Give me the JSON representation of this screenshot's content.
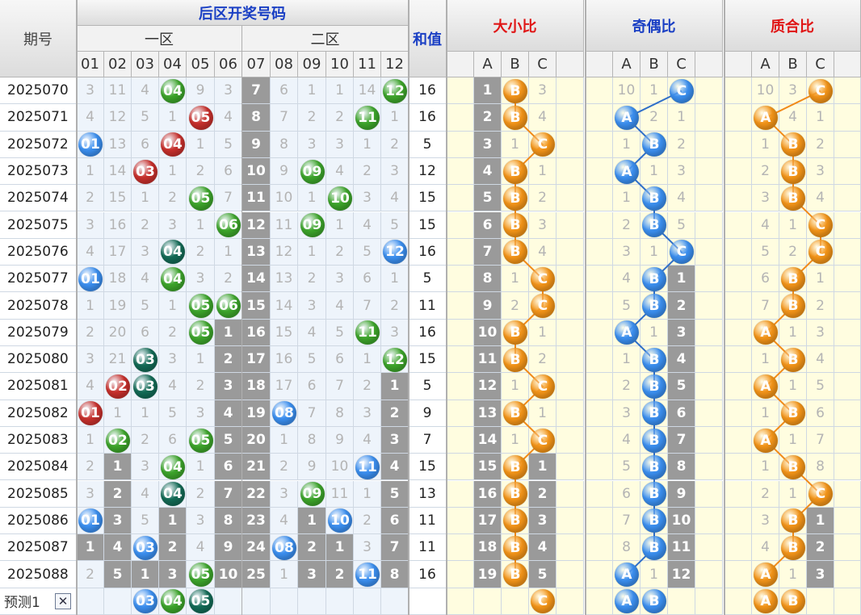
{
  "header": {
    "period": "期号",
    "back_zone": "后区开奖号码",
    "zone1": "一区",
    "zone2": "二区",
    "sum": "和值",
    "bigsmall": "大小比",
    "oddeven": "奇偶比",
    "primecomp": "质合比"
  },
  "numbers": [
    "01",
    "02",
    "03",
    "04",
    "05",
    "06",
    "07",
    "08",
    "09",
    "10",
    "11",
    "12"
  ],
  "abc": [
    "A",
    "B",
    "C"
  ],
  "colors": {
    "blue": "#3b8ff0",
    "red": "#c8302c",
    "green": "#3da52b",
    "teal": "#136b56",
    "orange": "#f39418"
  },
  "rows": [
    {
      "period": "2025070",
      "cells": [
        "3",
        "11",
        "4",
        "04",
        "9",
        "3",
        "7",
        "6",
        "1",
        "1",
        "14",
        "12"
      ],
      "balls": [
        {
          "col": 3,
          "color": "green"
        },
        {
          "col": 11,
          "color": "green"
        }
      ],
      "sum": "16",
      "bs": [
        "1",
        "B",
        "3"
      ],
      "oe": [
        "10",
        "1",
        "C"
      ],
      "pc": [
        "10",
        "3",
        "C"
      ]
    },
    {
      "period": "2025071",
      "cells": [
        "4",
        "12",
        "5",
        "1",
        "05",
        "4",
        "8",
        "7",
        "2",
        "2",
        "11",
        "1"
      ],
      "balls": [
        {
          "col": 4,
          "color": "red"
        },
        {
          "col": 10,
          "color": "green"
        }
      ],
      "sum": "16",
      "bs": [
        "2",
        "B",
        "4"
      ],
      "oe": [
        "A",
        "2",
        "1"
      ],
      "pc": [
        "A",
        "4",
        "1"
      ]
    },
    {
      "period": "2025072",
      "cells": [
        "01",
        "13",
        "6",
        "04",
        "1",
        "5",
        "9",
        "8",
        "3",
        "3",
        "1",
        "2"
      ],
      "balls": [
        {
          "col": 0,
          "color": "blue"
        },
        {
          "col": 3,
          "color": "red"
        }
      ],
      "sum": "5",
      "bs": [
        "3",
        "1",
        "C"
      ],
      "oe": [
        "1",
        "B",
        "2"
      ],
      "pc": [
        "1",
        "B",
        "2"
      ]
    },
    {
      "period": "2025073",
      "cells": [
        "1",
        "14",
        "03",
        "1",
        "2",
        "6",
        "10",
        "9",
        "09",
        "4",
        "2",
        "3"
      ],
      "balls": [
        {
          "col": 2,
          "color": "red"
        },
        {
          "col": 8,
          "color": "green"
        }
      ],
      "sum": "12",
      "bs": [
        "4",
        "B",
        "1"
      ],
      "oe": [
        "A",
        "1",
        "3"
      ],
      "pc": [
        "2",
        "B",
        "3"
      ]
    },
    {
      "period": "2025074",
      "cells": [
        "2",
        "15",
        "1",
        "2",
        "05",
        "7",
        "11",
        "10",
        "1",
        "10",
        "3",
        "4"
      ],
      "balls": [
        {
          "col": 4,
          "color": "green"
        },
        {
          "col": 9,
          "color": "green"
        }
      ],
      "sum": "15",
      "bs": [
        "5",
        "B",
        "2"
      ],
      "oe": [
        "1",
        "B",
        "4"
      ],
      "pc": [
        "3",
        "B",
        "4"
      ]
    },
    {
      "period": "2025075",
      "cells": [
        "3",
        "16",
        "2",
        "3",
        "1",
        "06",
        "12",
        "11",
        "09",
        "1",
        "4",
        "5"
      ],
      "balls": [
        {
          "col": 5,
          "color": "green"
        },
        {
          "col": 8,
          "color": "green"
        }
      ],
      "sum": "15",
      "bs": [
        "6",
        "B",
        "3"
      ],
      "oe": [
        "2",
        "B",
        "5"
      ],
      "pc": [
        "4",
        "1",
        "C"
      ]
    },
    {
      "period": "2025076",
      "cells": [
        "4",
        "17",
        "3",
        "04",
        "2",
        "1",
        "13",
        "12",
        "1",
        "2",
        "5",
        "12"
      ],
      "balls": [
        {
          "col": 3,
          "color": "teal"
        },
        {
          "col": 11,
          "color": "blue"
        }
      ],
      "sum": "16",
      "bs": [
        "7",
        "B",
        "4"
      ],
      "oe": [
        "3",
        "1",
        "C"
      ],
      "pc": [
        "5",
        "2",
        "C"
      ]
    },
    {
      "period": "2025077",
      "cells": [
        "01",
        "18",
        "4",
        "04",
        "3",
        "2",
        "14",
        "13",
        "2",
        "3",
        "6",
        "1"
      ],
      "balls": [
        {
          "col": 0,
          "color": "blue"
        },
        {
          "col": 3,
          "color": "green"
        }
      ],
      "sum": "5",
      "bs": [
        "8",
        "1",
        "C"
      ],
      "oe": [
        "4",
        "B",
        "1"
      ],
      "pc": [
        "6",
        "B",
        "1"
      ]
    },
    {
      "period": "2025078",
      "cells": [
        "1",
        "19",
        "5",
        "1",
        "05",
        "06",
        "15",
        "14",
        "3",
        "4",
        "7",
        "2"
      ],
      "balls": [
        {
          "col": 4,
          "color": "green"
        },
        {
          "col": 5,
          "color": "green"
        }
      ],
      "sum": "11",
      "bs": [
        "9",
        "2",
        "C"
      ],
      "oe": [
        "5",
        "B",
        "2"
      ],
      "pc": [
        "7",
        "B",
        "2"
      ]
    },
    {
      "period": "2025079",
      "cells": [
        "2",
        "20",
        "6",
        "2",
        "05",
        "1",
        "16",
        "15",
        "4",
        "5",
        "11",
        "3"
      ],
      "balls": [
        {
          "col": 4,
          "color": "green"
        },
        {
          "col": 10,
          "color": "green"
        }
      ],
      "sum": "16",
      "bs": [
        "10",
        "B",
        "1"
      ],
      "oe": [
        "A",
        "1",
        "3"
      ],
      "pc": [
        "A",
        "1",
        "3"
      ]
    },
    {
      "period": "2025080",
      "cells": [
        "3",
        "21",
        "03",
        "3",
        "1",
        "2",
        "17",
        "16",
        "5",
        "6",
        "1",
        "12"
      ],
      "balls": [
        {
          "col": 2,
          "color": "teal"
        },
        {
          "col": 11,
          "color": "green"
        }
      ],
      "sum": "15",
      "bs": [
        "11",
        "B",
        "2"
      ],
      "oe": [
        "1",
        "B",
        "4"
      ],
      "pc": [
        "1",
        "B",
        "4"
      ]
    },
    {
      "period": "2025081",
      "cells": [
        "4",
        "02",
        "03",
        "4",
        "2",
        "3",
        "18",
        "17",
        "6",
        "7",
        "2",
        "1"
      ],
      "balls": [
        {
          "col": 1,
          "color": "red"
        },
        {
          "col": 2,
          "color": "teal"
        }
      ],
      "sum": "5",
      "bs": [
        "12",
        "1",
        "C"
      ],
      "oe": [
        "2",
        "B",
        "5"
      ],
      "pc": [
        "A",
        "1",
        "5"
      ]
    },
    {
      "period": "2025082",
      "cells": [
        "01",
        "1",
        "1",
        "5",
        "3",
        "4",
        "19",
        "08",
        "7",
        "8",
        "3",
        "2"
      ],
      "balls": [
        {
          "col": 0,
          "color": "red"
        },
        {
          "col": 7,
          "color": "blue"
        }
      ],
      "sum": "9",
      "bs": [
        "13",
        "B",
        "1"
      ],
      "oe": [
        "3",
        "B",
        "6"
      ],
      "pc": [
        "1",
        "B",
        "6"
      ]
    },
    {
      "period": "2025083",
      "cells": [
        "1",
        "02",
        "2",
        "6",
        "05",
        "5",
        "20",
        "1",
        "8",
        "9",
        "4",
        "3"
      ],
      "balls": [
        {
          "col": 1,
          "color": "green"
        },
        {
          "col": 4,
          "color": "green"
        }
      ],
      "sum": "7",
      "bs": [
        "14",
        "1",
        "C"
      ],
      "oe": [
        "4",
        "B",
        "7"
      ],
      "pc": [
        "A",
        "1",
        "7"
      ]
    },
    {
      "period": "2025084",
      "cells": [
        "2",
        "1",
        "3",
        "04",
        "1",
        "6",
        "21",
        "2",
        "9",
        "10",
        "11",
        "4"
      ],
      "balls": [
        {
          "col": 3,
          "color": "green"
        },
        {
          "col": 10,
          "color": "blue"
        }
      ],
      "sum": "15",
      "bs": [
        "15",
        "B",
        "1"
      ],
      "oe": [
        "5",
        "B",
        "8"
      ],
      "pc": [
        "1",
        "B",
        "8"
      ]
    },
    {
      "period": "2025085",
      "cells": [
        "3",
        "2",
        "4",
        "04",
        "2",
        "7",
        "22",
        "3",
        "09",
        "11",
        "1",
        "5"
      ],
      "balls": [
        {
          "col": 3,
          "color": "teal"
        },
        {
          "col": 8,
          "color": "green"
        }
      ],
      "sum": "13",
      "bs": [
        "16",
        "B",
        "2"
      ],
      "oe": [
        "6",
        "B",
        "9"
      ],
      "pc": [
        "2",
        "1",
        "C"
      ]
    },
    {
      "period": "2025086",
      "cells": [
        "01",
        "3",
        "5",
        "1",
        "3",
        "8",
        "23",
        "4",
        "1",
        "10",
        "2",
        "6"
      ],
      "balls": [
        {
          "col": 0,
          "color": "blue"
        },
        {
          "col": 9,
          "color": "blue"
        }
      ],
      "sum": "11",
      "bs": [
        "17",
        "B",
        "3"
      ],
      "oe": [
        "7",
        "B",
        "10"
      ],
      "pc": [
        "3",
        "B",
        "1"
      ]
    },
    {
      "period": "2025087",
      "cells": [
        "1",
        "4",
        "03",
        "2",
        "4",
        "9",
        "24",
        "08",
        "2",
        "1",
        "3",
        "7"
      ],
      "balls": [
        {
          "col": 2,
          "color": "blue"
        },
        {
          "col": 7,
          "color": "blue"
        }
      ],
      "sum": "11",
      "bs": [
        "18",
        "B",
        "4"
      ],
      "oe": [
        "8",
        "B",
        "11"
      ],
      "pc": [
        "4",
        "B",
        "2"
      ]
    },
    {
      "period": "2025088",
      "cells": [
        "2",
        "5",
        "1",
        "3",
        "05",
        "10",
        "25",
        "1",
        "3",
        "2",
        "11",
        "8"
      ],
      "balls": [
        {
          "col": 4,
          "color": "green"
        },
        {
          "col": 10,
          "color": "blue"
        }
      ],
      "sum": "16",
      "bs": [
        "19",
        "B",
        "5"
      ],
      "oe": [
        "A",
        "1",
        "12"
      ],
      "pc": [
        "A",
        "1",
        "3"
      ]
    }
  ],
  "predict": {
    "label": "预测1",
    "close": "✕",
    "balls": [
      {
        "col": 2,
        "num": "03",
        "color": "blue"
      },
      {
        "col": 3,
        "num": "04",
        "color": "green"
      },
      {
        "col": 4,
        "num": "05",
        "color": "teal"
      }
    ],
    "bs": [
      "C"
    ],
    "oe": [
      "A",
      "B"
    ],
    "pc": [
      "A",
      "B"
    ]
  }
}
